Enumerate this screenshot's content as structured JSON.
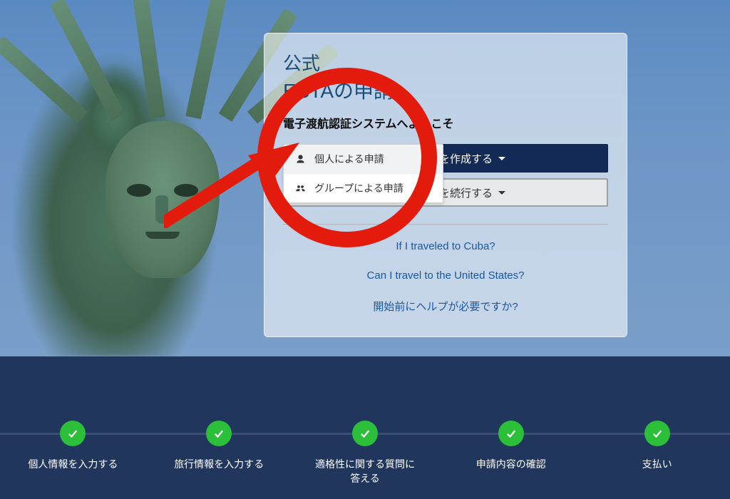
{
  "card": {
    "title_small": "公式",
    "title_big": "ESTAの申請",
    "subtitle": "電子渡航認証システムへようこそ",
    "create_label": "新規に申請を作成する",
    "continue_label": "既存の申請を続行する",
    "link1": "If I traveled to Cuba?",
    "link2": "Can I travel to the United States?",
    "link3": "開始前にヘルプが必要ですか?"
  },
  "dropdown": {
    "individual": "個人による申請",
    "group": "グループによる申請"
  },
  "steps": [
    {
      "label": "個人情報を入力する"
    },
    {
      "label": "旅行情報を入力する"
    },
    {
      "label": "適格性に関する質問に\n答える"
    },
    {
      "label": "申請内容の確認"
    },
    {
      "label": "支払い"
    }
  ],
  "colors": {
    "accent_red": "#e31b0c",
    "primary_navy": "#122a55",
    "link_blue": "#1857a4",
    "step_green": "#2bbf3a",
    "band_navy": "#20365c"
  }
}
